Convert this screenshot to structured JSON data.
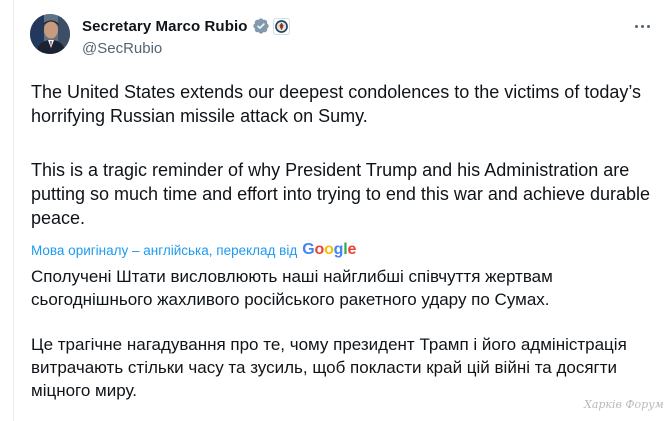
{
  "author": {
    "display_name": "Secretary Marco Rubio",
    "handle": "@SecRubio",
    "verified_badge_color": "#829aab"
  },
  "tweet": {
    "paragraph_1": "The United States extends our deepest condolences to the victims of today’s horrifying Russian missile attack on Sumy.",
    "paragraph_2": "This is a tragic reminder of why President Trump and his Administration are putting so much time and effort into trying to end this war and achieve durable peace."
  },
  "translation": {
    "label": "Мова оригіналу – англійська, переклад від",
    "provider": "Google",
    "paragraph_1": "Сполучені Штати висловлюють наші найглибші співчуття жертвам сьогоднішнього жахливого російського ракетного удару по Сумах.",
    "paragraph_2": "Це трагічне нагадування про те, чому президент Трамп і його адміністрація витрачають стільки часу та зусиль, щоб покласти край цій війні та досягти міцного миру."
  },
  "watermark": "Харків Форум",
  "icons": {
    "verified": "verified-badge-icon",
    "affiliation": "state-department-seal-icon",
    "more": "more-options-icon"
  },
  "colors": {
    "link": "#1d9bf0",
    "text": "#0f1419",
    "secondary": "#536471"
  }
}
